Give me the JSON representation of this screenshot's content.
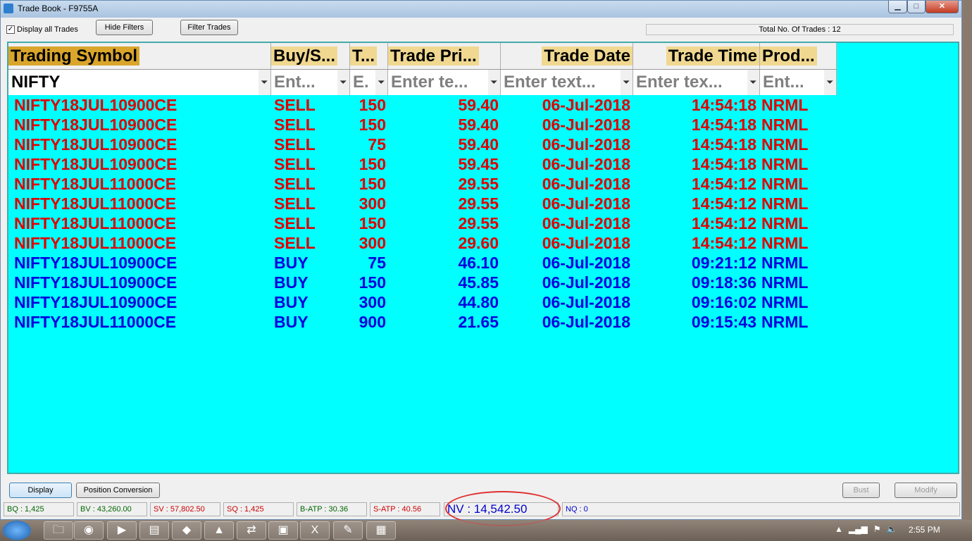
{
  "window": {
    "title": "Trade Book - F9755A",
    "min": "▁",
    "max": "□",
    "close": "✕"
  },
  "toolbar": {
    "display_all_label": "Display all Trades",
    "display_all_checked": "✓",
    "hide_filters": "Hide Filters",
    "filter_trades": "Filter Trades",
    "total_trades": "Total No. Of Trades : 12"
  },
  "columns": [
    {
      "label": "Trading Symbol",
      "bg": "#d9a52b"
    },
    {
      "label": "Buy/S...",
      "bg": "#f0d890"
    },
    {
      "label": "T...",
      "bg": "#f0d890"
    },
    {
      "label": "Trade Pri...",
      "bg": "#f0d890"
    },
    {
      "label": "Trade Date",
      "bg": "#f0d890"
    },
    {
      "label": "Trade Time",
      "bg": "#f0d890"
    },
    {
      "label": "Prod...",
      "bg": "#f0d890"
    }
  ],
  "filters": [
    "NIFTY",
    "Ent...",
    "E.",
    "Enter te...",
    "Enter text...",
    "Enter tex...",
    "Ent..."
  ],
  "trades": [
    [
      "NIFTY18JUL10900CE",
      "SELL",
      "150",
      "59.40",
      "06-Jul-2018",
      "14:54:18",
      "NRML"
    ],
    [
      "NIFTY18JUL10900CE",
      "SELL",
      "150",
      "59.40",
      "06-Jul-2018",
      "14:54:18",
      "NRML"
    ],
    [
      "NIFTY18JUL10900CE",
      "SELL",
      "75",
      "59.40",
      "06-Jul-2018",
      "14:54:18",
      "NRML"
    ],
    [
      "NIFTY18JUL10900CE",
      "SELL",
      "150",
      "59.45",
      "06-Jul-2018",
      "14:54:18",
      "NRML"
    ],
    [
      "NIFTY18JUL11000CE",
      "SELL",
      "150",
      "29.55",
      "06-Jul-2018",
      "14:54:12",
      "NRML"
    ],
    [
      "NIFTY18JUL11000CE",
      "SELL",
      "300",
      "29.55",
      "06-Jul-2018",
      "14:54:12",
      "NRML"
    ],
    [
      "NIFTY18JUL11000CE",
      "SELL",
      "150",
      "29.55",
      "06-Jul-2018",
      "14:54:12",
      "NRML"
    ],
    [
      "NIFTY18JUL11000CE",
      "SELL",
      "300",
      "29.60",
      "06-Jul-2018",
      "14:54:12",
      "NRML"
    ],
    [
      "NIFTY18JUL10900CE",
      "BUY",
      "75",
      "46.10",
      "06-Jul-2018",
      "09:21:12",
      "NRML"
    ],
    [
      "NIFTY18JUL10900CE",
      "BUY",
      "150",
      "45.85",
      "06-Jul-2018",
      "09:18:36",
      "NRML"
    ],
    [
      "NIFTY18JUL10900CE",
      "BUY",
      "300",
      "44.80",
      "06-Jul-2018",
      "09:16:02",
      "NRML"
    ],
    [
      "NIFTY18JUL11000CE",
      "BUY",
      "900",
      "21.65",
      "06-Jul-2018",
      "09:15:43",
      "NRML"
    ]
  ],
  "colors": {
    "sell": "#e00000",
    "buy": "#0000dd",
    "grid_bg": "#00ffff"
  },
  "buttons": {
    "display": "Display",
    "position_conversion": "Position Conversion",
    "bust": "Bust",
    "modify": "Modify"
  },
  "status": [
    {
      "id": "bq",
      "text": "BQ : 1,425",
      "color": "#006600"
    },
    {
      "id": "bv",
      "text": "BV : 43,260.00",
      "color": "#006600"
    },
    {
      "id": "sv",
      "text": "SV : 57,802.50",
      "color": "#cc0000"
    },
    {
      "id": "sq",
      "text": "SQ : 1,425",
      "color": "#cc0000"
    },
    {
      "id": "batp",
      "text": "B-ATP : 30.36",
      "color": "#006600"
    },
    {
      "id": "satp",
      "text": "S-ATP : 40.56",
      "color": "#cc0000"
    },
    {
      "id": "nv",
      "text": "NV : 14,542.50",
      "color": "#0000cc"
    },
    {
      "id": "nq",
      "text": "NQ : 0",
      "color": "#0000cc"
    }
  ],
  "taskbar": {
    "apps": [
      "folder-icon",
      "chrome-icon",
      "media-player-icon",
      "notepad-icon",
      "chart-app-icon",
      "triangle-app-icon",
      "network-app-icon",
      "window-app-icon",
      "excel-icon",
      "pdf-icon",
      "calculator-icon"
    ],
    "clock": "2:55 PM"
  }
}
